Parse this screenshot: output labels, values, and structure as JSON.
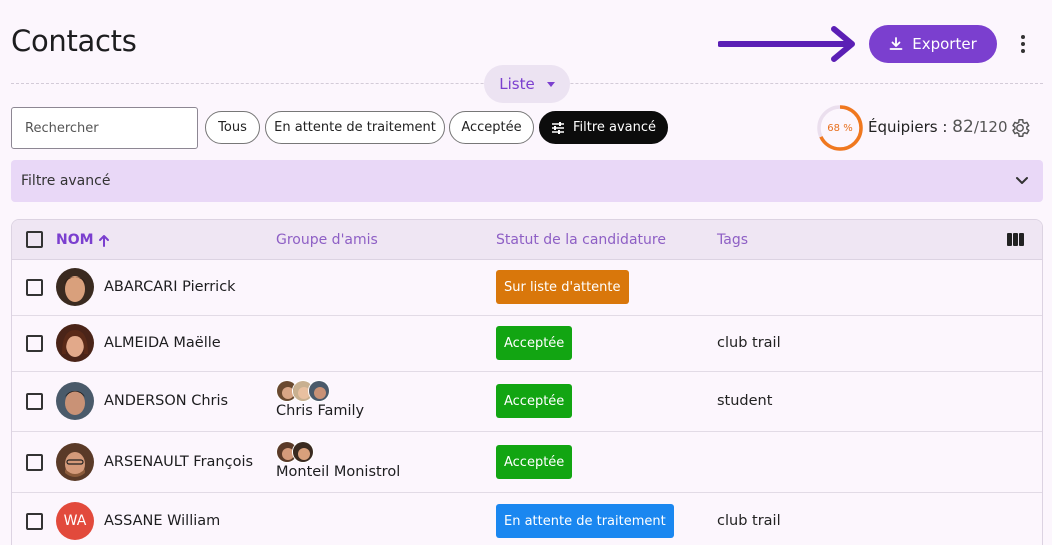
{
  "page": {
    "title": "Contacts"
  },
  "header": {
    "export_label": "Exporter"
  },
  "view": {
    "label": "Liste"
  },
  "search": {
    "placeholder": "Rechercher"
  },
  "filters": {
    "chips": [
      "Tous",
      "En attente de traitement",
      "Acceptée"
    ],
    "advanced_label": "Filtre avancé"
  },
  "capacity": {
    "percent_label": "68 %",
    "percent": 68,
    "label": "Équipiers : ",
    "current": "82",
    "total": "/120"
  },
  "filter_bar": {
    "label": "Filtre avancé"
  },
  "table": {
    "columns": {
      "name": "NOM",
      "group": "Groupe d'amis",
      "status": "Statut de la candidature",
      "tags": "Tags"
    },
    "rows": [
      {
        "name": "ABARCARI Pierrick",
        "group": "",
        "status": "Sur liste d'attente",
        "status_color": "#d9770b",
        "tag": ""
      },
      {
        "name": "ALMEIDA Maëlle",
        "group": "",
        "status": "Acceptée",
        "status_color": "#12a512",
        "tag": "club trail"
      },
      {
        "name": "ANDERSON Chris",
        "group": "Chris Family",
        "status": "Acceptée",
        "status_color": "#12a512",
        "tag": "student"
      },
      {
        "name": "ARSENAULT François",
        "group": "Monteil Monistrol",
        "status": "Acceptée",
        "status_color": "#12a512",
        "tag": ""
      },
      {
        "name": "ASSANE William",
        "initials": "WA",
        "group": "",
        "status": "En attente de traitement",
        "status_color": "#1a87f0",
        "tag": "club trail"
      }
    ]
  },
  "colors": {
    "accent": "#7b3fcf",
    "filter_bg": "#e9d8f7",
    "progress": "#f0781f"
  }
}
